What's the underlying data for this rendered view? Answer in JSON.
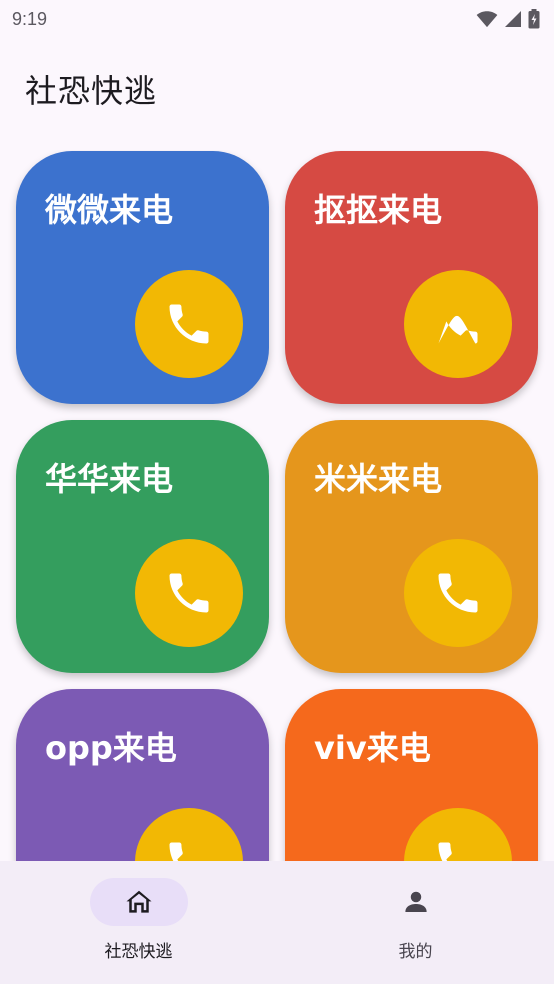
{
  "status_bar": {
    "time": "9:19",
    "icons": [
      "wifi-icon",
      "signal-icon",
      "battery-charging-icon"
    ]
  },
  "header": {
    "title": "社恐快逃"
  },
  "cards": [
    {
      "label": "微微来电",
      "color": "#3c72ce",
      "icon": "phone-icon"
    },
    {
      "label": "抠抠来电",
      "color": "#d64a43",
      "icon": "phone-icon"
    },
    {
      "label": "华华来电",
      "color": "#349e5e",
      "icon": "phone-icon"
    },
    {
      "label": "米米来电",
      "color": "#e5961c",
      "icon": "phone-icon"
    },
    {
      "label": "opp来电",
      "color": "#7c5ab4",
      "icon": "phone-icon"
    },
    {
      "label": "viv来电",
      "color": "#f5691c",
      "icon": "phone-icon"
    }
  ],
  "call_button_color": "#f2b804",
  "bottom_nav": {
    "items": [
      {
        "label": "社恐快逃",
        "icon": "home-icon",
        "active": true
      },
      {
        "label": "我的",
        "icon": "person-icon",
        "active": false
      }
    ]
  }
}
